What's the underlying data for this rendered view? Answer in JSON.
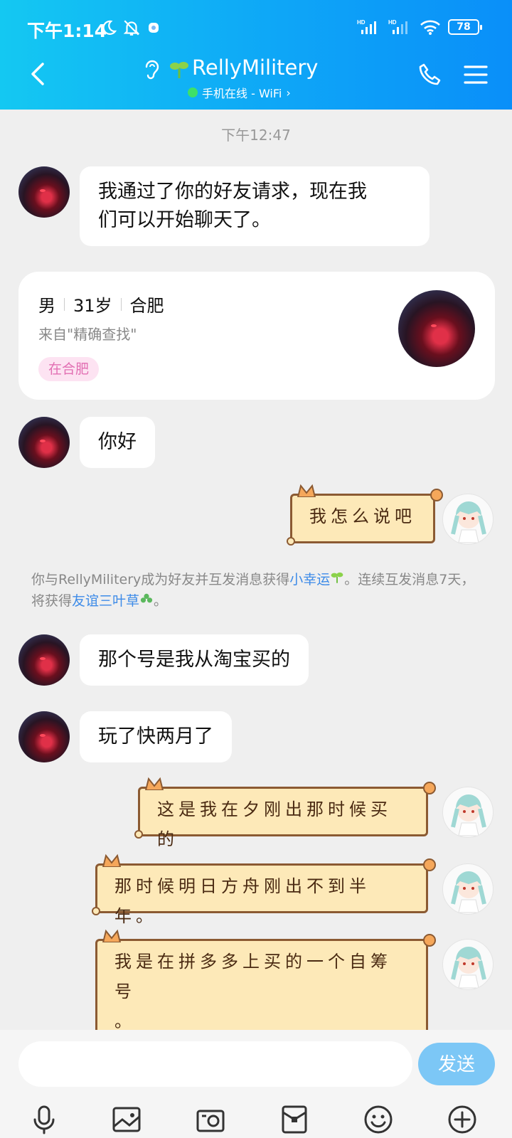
{
  "status_bar": {
    "time": "下午1:14",
    "battery": "78",
    "network_1": "HD",
    "network_2": "HD"
  },
  "header": {
    "contact_name": "RellyMilitery",
    "presence": "手机在线 - WiFi",
    "chevron": "›"
  },
  "chat": {
    "timestamp": "下午12:47",
    "messages": [
      {
        "from": "other",
        "text_line1": "我通过了你的好友请求，现在我",
        "text_line2": "们可以开始聊天了。"
      },
      {
        "from": "other",
        "text": "你好"
      },
      {
        "from": "me",
        "text": "我怎么说吧"
      },
      {
        "from": "other",
        "text": "那个号是我从淘宝买的"
      },
      {
        "from": "other",
        "text": "玩了快两月了"
      },
      {
        "from": "me",
        "text": "这是我在夕刚出那时候买的"
      },
      {
        "from": "me",
        "text": "那时候明日方舟刚出不到半年。"
      },
      {
        "from": "me",
        "text_line1": "我是在拼多多上买的一个自筹号",
        "text_line2": "。"
      }
    ]
  },
  "profile_card": {
    "gender": "男",
    "age": "31岁",
    "city": "合肥",
    "source": "来自\"精确查找\"",
    "tag": "在合肥"
  },
  "system_message": {
    "part1": "你与RellyMilitery成为好友并互发消息获得",
    "link1": "小幸运",
    "part2": "。连续互发消息7天，将获得",
    "link2": "友谊三叶草",
    "part3": "。"
  },
  "input": {
    "placeholder": "",
    "send_label": "发送"
  },
  "icons": {
    "toolbar": [
      "microphone-icon",
      "image-icon",
      "camera-icon",
      "red-packet-icon",
      "emoji-icon",
      "plus-icon"
    ]
  }
}
